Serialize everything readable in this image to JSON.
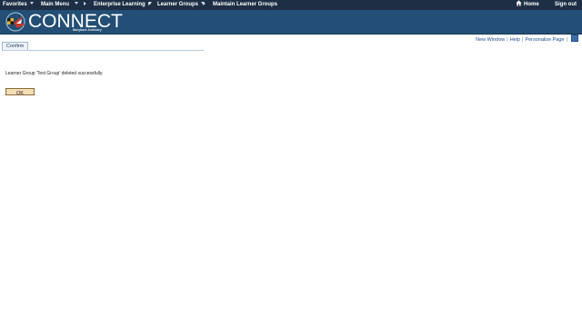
{
  "nav": {
    "favorites": "Favorites",
    "main_menu": "Main Menu",
    "enterprise_learning": "Enterprise Learning",
    "learner_groups": "Learner Groups",
    "maintain_learner_groups": "Maintain Learner Groups",
    "home": "Home",
    "sign_out": "Sign out"
  },
  "brand": {
    "title": "CONNECT",
    "subtitle": "Maryland Judiciary"
  },
  "page_links": {
    "new_window": "New Window",
    "help": "Help",
    "personalize_page": "Personalize Page"
  },
  "tabs": [
    {
      "label": "Confirm"
    }
  ],
  "message": "Learner Group 'Test Group' deleted successfully.",
  "ok_button": "OK",
  "colors": {
    "topbar": "#1e2f45",
    "header": "#234e75",
    "ok_button": "#f3dfb6",
    "link": "#1f4e91"
  }
}
